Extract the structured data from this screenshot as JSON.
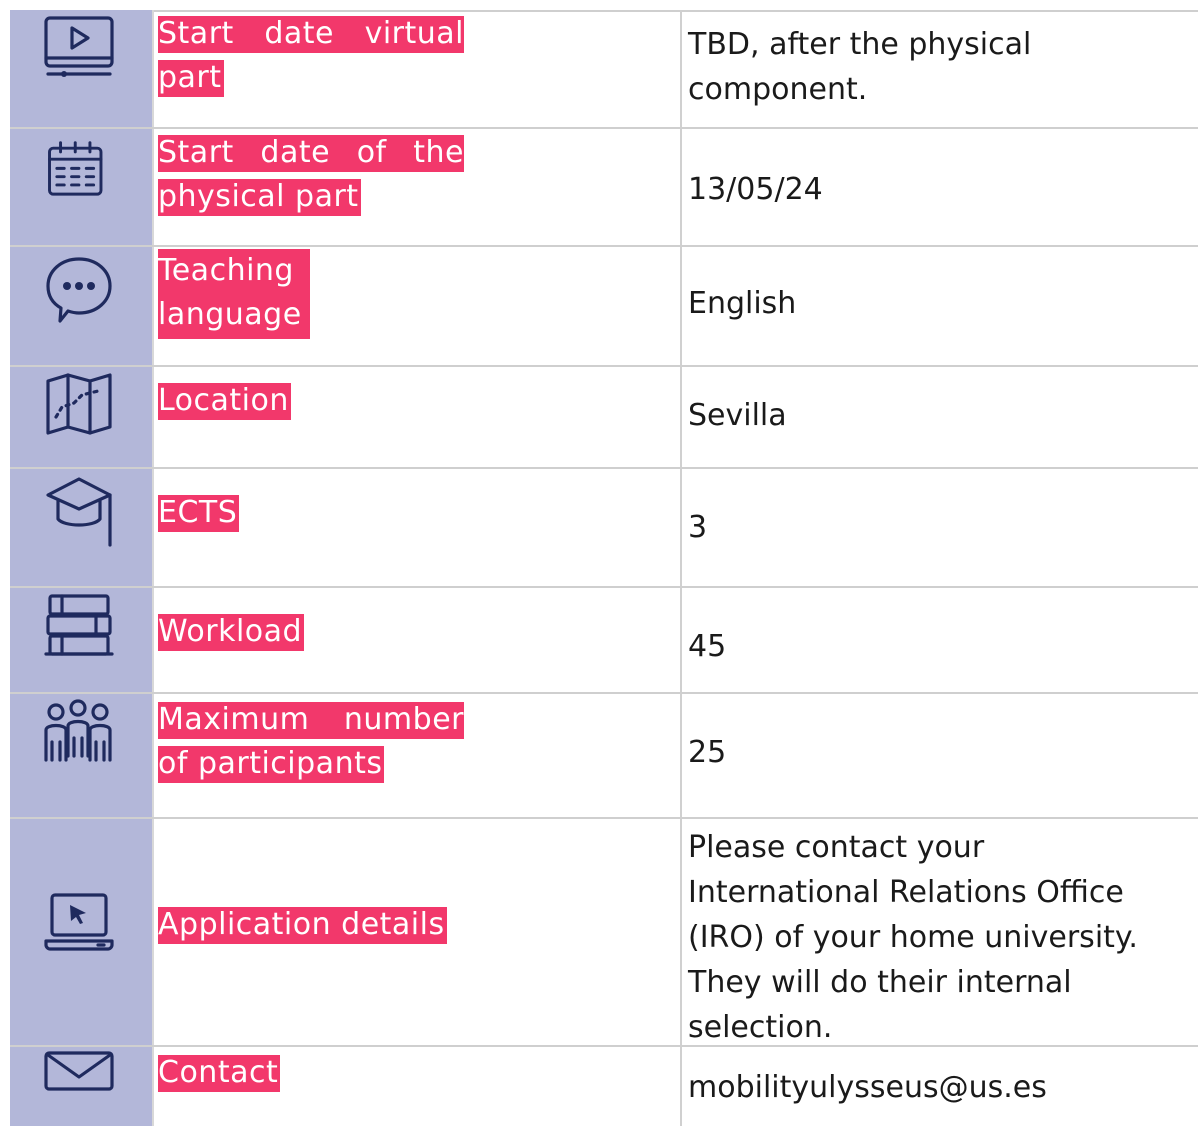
{
  "rows": [
    {
      "icon": "monitor-play-icon",
      "label": "Start date virtual part",
      "value": "TBD, after the physical component."
    },
    {
      "icon": "calendar-icon",
      "label": "Start date of the physical part",
      "value": "13/05/24"
    },
    {
      "icon": "chat-bubble-icon",
      "label": "Teaching language",
      "value": "English"
    },
    {
      "icon": "map-icon",
      "label": "Location",
      "value": "Sevilla"
    },
    {
      "icon": "graduation-cap-icon",
      "label": "ECTS",
      "value": "3"
    },
    {
      "icon": "books-icon",
      "label": "Workload",
      "value": "45"
    },
    {
      "icon": "people-group-icon",
      "label": "Maximum number of participants",
      "value": "25"
    },
    {
      "icon": "laptop-cursor-icon",
      "label": "Application details",
      "value": "Please contact your International Relations Office (IRO) of your home university. They will do their internal selection."
    },
    {
      "icon": "envelope-icon",
      "label": "Contact",
      "value": "mobilityulysseus@us.es"
    }
  ],
  "colors": {
    "icon_column": "#b3b7d9",
    "label_highlight": "#f2386b",
    "icon_stroke": "#1f2a5e"
  }
}
